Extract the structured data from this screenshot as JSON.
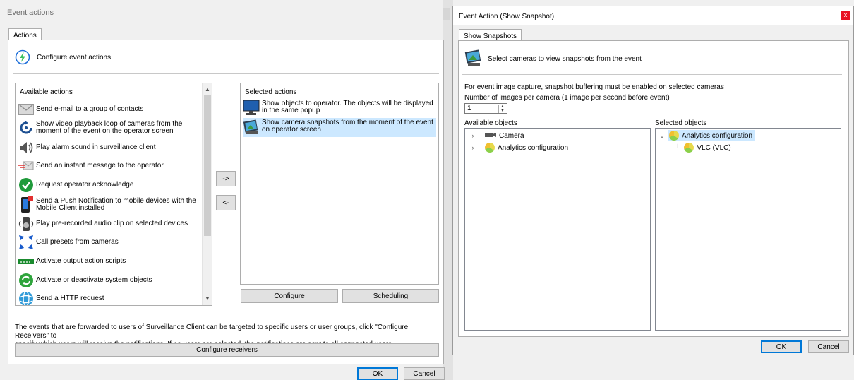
{
  "left_dialog": {
    "title": "Event actions",
    "tab_label": "Actions",
    "heading": "Configure event actions",
    "available_header": "Available actions",
    "available_actions": [
      {
        "label_lines": [
          "Send e-mail to a group of contacts"
        ],
        "icon": "mail-icon"
      },
      {
        "label_lines": [
          "Show video playback loop of cameras from the",
          "moment of the event on the operator screen"
        ],
        "icon": "playback-loop-icon"
      },
      {
        "label_lines": [
          "Play alarm sound in surveillance client"
        ],
        "icon": "speaker-icon"
      },
      {
        "label_lines": [
          "Send an instant message to the operator"
        ],
        "icon": "instant-message-icon"
      },
      {
        "label_lines": [
          "Request operator acknowledge"
        ],
        "icon": "checkmark-icon"
      },
      {
        "label_lines": [
          "Send a Push Notification to mobile devices with the",
          "Mobile Client installed"
        ],
        "icon": "mobile-phone-icon"
      },
      {
        "label_lines": [
          "Play pre-recorded audio clip on selected devices"
        ],
        "icon": "audio-device-icon"
      },
      {
        "label_lines": [
          "Call presets from cameras"
        ],
        "icon": "ptz-presets-icon"
      },
      {
        "label_lines": [
          "Activate output action scripts"
        ],
        "icon": "output-script-icon"
      },
      {
        "label_lines": [
          "Activate or deactivate system objects"
        ],
        "icon": "toggle-objects-icon"
      },
      {
        "label_lines": [
          "Send a HTTP request"
        ],
        "icon": "http-request-icon"
      }
    ],
    "add_button": "->",
    "remove_button": "<-",
    "selected_header": "Selected actions",
    "selected_actions": [
      {
        "label_lines": [
          "Show objects to operator. The objects will be displayed",
          "in the same popup"
        ],
        "icon": "monitor-icon",
        "selected": false
      },
      {
        "label_lines": [
          "Show camera snapshots from the moment of the event",
          "on operator screen"
        ],
        "icon": "snapshot-icon",
        "selected": true
      }
    ],
    "configure_button": "Configure",
    "scheduling_button": "Scheduling",
    "info_text_lines": [
      "The events that are forwarded to users of Surveillance Client can be targeted to specific users or user groups, click \"Configure Receivers\" to",
      "specify which users will receive the notifications. If no users are selected, the notifications are sent to all connected users."
    ],
    "configure_receivers_button": "Configure receivers",
    "ok_button": "OK",
    "cancel_button": "Cancel"
  },
  "right_dialog": {
    "title": "Event Action (Show Snapshot)",
    "close_glyph": "x",
    "tab_label": "Show Snapshots",
    "heading": "Select cameras to view snapshots from the event",
    "info_text": "For event image capture, snapshot buffering must be enabled on selected cameras",
    "images_label": "Number of images per camera (1 image per second before event)",
    "images_value": "1",
    "available_header": "Available objects",
    "available_tree": [
      {
        "label": "Camera",
        "icon": "camera-icon"
      },
      {
        "label": "Analytics configuration",
        "icon": "analytics-icon"
      }
    ],
    "selected_header": "Selected objects",
    "selected_tree": [
      {
        "label": "Analytics configuration",
        "icon": "analytics-icon",
        "selected": true
      },
      {
        "label": "VLC (VLC)",
        "icon": "analytics-icon",
        "selected": false
      }
    ],
    "ok_button": "OK",
    "cancel_button": "Cancel"
  },
  "colors": {
    "selection": "#cce8ff",
    "accent": "#0078d7",
    "close": "#e81123"
  }
}
